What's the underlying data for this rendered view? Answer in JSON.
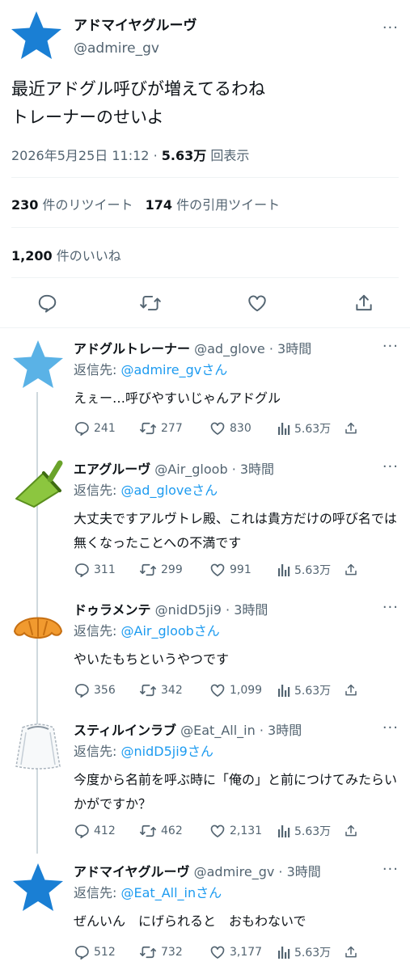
{
  "main_tweet": {
    "display_name": "アドマイヤグルーヴ",
    "handle": "@admire_gv",
    "text_lines": [
      "最近アドグル呼びが増えてるわね",
      "トレーナーのせいよ"
    ],
    "timestamp": "2026年5月25日 11:12",
    "separator": "·",
    "views_count": "5.63万",
    "views_label": "回表示",
    "retweets_count": "230",
    "retweets_label": "件のリツイート",
    "quotes_count": "174",
    "quotes_label": "件の引用ツイート",
    "likes_count": "1,200",
    "likes_label": "件のいいね",
    "more": "···"
  },
  "reply_to_label": "返信先:",
  "replies": [
    {
      "display_name": "アドグルトレーナー",
      "handle": "@ad_glove",
      "time": "· 3時間",
      "reply_to": "@admire_gvさん",
      "text": "えぇー…呼びやすいじゃんアドグル",
      "replies": "241",
      "retweets": "277",
      "likes": "830",
      "views": "5.63万",
      "avatar": "light-blue-star-icon"
    },
    {
      "display_name": "エアグルーヴ",
      "handle": "@Air_gloob",
      "time": "· 3時間",
      "reply_to": "@ad_gloveさん",
      "text": "大丈夫ですアルヴトレ殿、これは貴方だけの呼び名では無くなったことへの不満です",
      "replies": "311",
      "retweets": "299",
      "likes": "991",
      "views": "5.63万",
      "avatar": "green-dustpan-icon"
    },
    {
      "display_name": "ドゥラメンテ",
      "handle": "@nidD5ji9",
      "time": "· 3時間",
      "reply_to": "@Air_gloobさん",
      "text": "やいたもちというやつです",
      "replies": "356",
      "retweets": "342",
      "likes": "1,099",
      "views": "5.63万",
      "avatar": "croissant-icon"
    },
    {
      "display_name": "スティルインラブ",
      "handle": "@Eat_All_in",
      "time": "· 3時間",
      "reply_to": "@nidD5ji9さん",
      "text": "今度から名前を呼ぶ時に「俺の」と前につけてみたらいかがですか？",
      "replies": "412",
      "retweets": "462",
      "likes": "2,131",
      "views": "5.63万",
      "avatar": "veil-icon"
    },
    {
      "display_name": "アドマイヤグルーヴ",
      "handle": "@admire_gv",
      "time": "· 3時間",
      "reply_to": "@Eat_All_inさん",
      "text": "ぜんいん　にげられると　おもわないで",
      "replies": "512",
      "retweets": "732",
      "likes": "3,177",
      "views": "5.63万",
      "avatar": "blue-star-icon"
    }
  ],
  "colors": {
    "accent": "#1d9bf0",
    "star_blue": "#1a7fd4",
    "star_light": "#5ab2e6",
    "text_gray": "#536471"
  }
}
